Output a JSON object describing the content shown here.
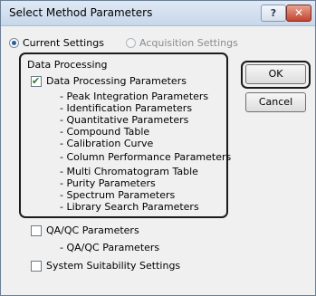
{
  "window": {
    "title": "Select Method Parameters",
    "help_label": "?",
    "close_label": "✕"
  },
  "settings_mode": {
    "current_label": "Current Settings",
    "acquisition_label": "Acquisition Settings",
    "selected": "current"
  },
  "data_processing": {
    "group_label": "Data Processing",
    "main_label": "Data Processing Parameters",
    "checked": true,
    "items": [
      "- Peak Integration Parameters",
      "- Identification Parameters",
      "- Quantitative Parameters",
      "- Compound Table",
      "- Calibration Curve",
      "- Column Performance Parameters",
      "- Multi Chromatogram Table",
      "- Purity Parameters",
      "- Spectrum Parameters",
      "- Library Search Parameters"
    ]
  },
  "qa_qc": {
    "label": "QA/QC Parameters",
    "checked": false,
    "sub_label": "- QA/QC Parameters"
  },
  "system_suitability": {
    "label": "System Suitability Settings",
    "checked": false
  },
  "buttons": {
    "ok_label": "OK",
    "cancel_label": "Cancel"
  }
}
